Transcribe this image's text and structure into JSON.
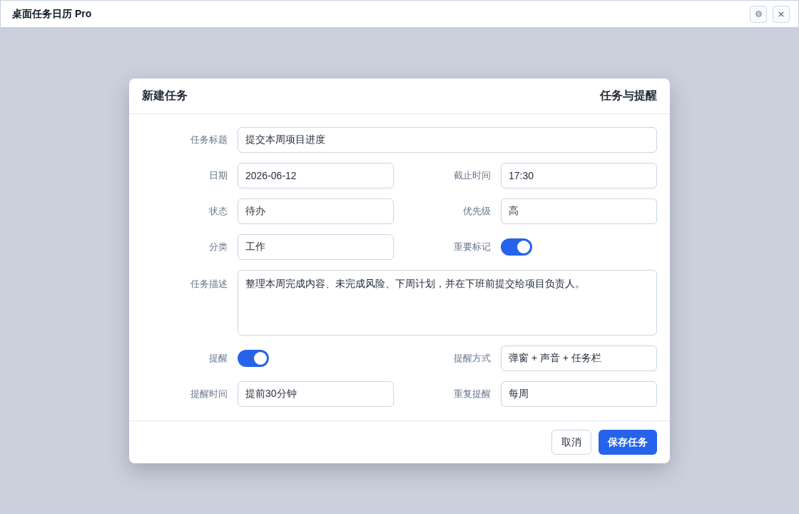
{
  "window": {
    "title": "桌面任务日历 Pro"
  },
  "dialog": {
    "title": "新建任务",
    "subtitle": "任务与提醒",
    "fields": [
      {
        "kind": "wide",
        "label": "任务标题",
        "value": "提交本周项目进度"
      },
      {
        "kind": "text",
        "label": "日期",
        "value": "2026-06-12"
      },
      {
        "kind": "text",
        "label": "截止时间",
        "value": "17:30"
      },
      {
        "kind": "text",
        "label": "状态",
        "value": "待办"
      },
      {
        "kind": "text",
        "label": "优先级",
        "value": "高"
      },
      {
        "kind": "text",
        "label": "分类",
        "value": "工作"
      },
      {
        "kind": "toggle",
        "label": "重要标记",
        "on": true
      },
      {
        "kind": "textarea",
        "label": "任务描述",
        "value": "整理本周完成内容、未完成风险、下周计划，并在下班前提交给项目负责人。"
      },
      {
        "kind": "toggle",
        "label": "提醒",
        "on": true
      },
      {
        "kind": "text",
        "label": "提醒方式",
        "value": "弹窗 + 声音 + 任务栏"
      },
      {
        "kind": "text",
        "label": "提醒时间",
        "value": "提前30分钟"
      },
      {
        "kind": "text",
        "label": "重复提醒",
        "value": "每周"
      }
    ],
    "buttons": [
      {
        "kind": "secondary",
        "label": "取消"
      },
      {
        "kind": "primary",
        "label": "保存任务"
      }
    ]
  }
}
